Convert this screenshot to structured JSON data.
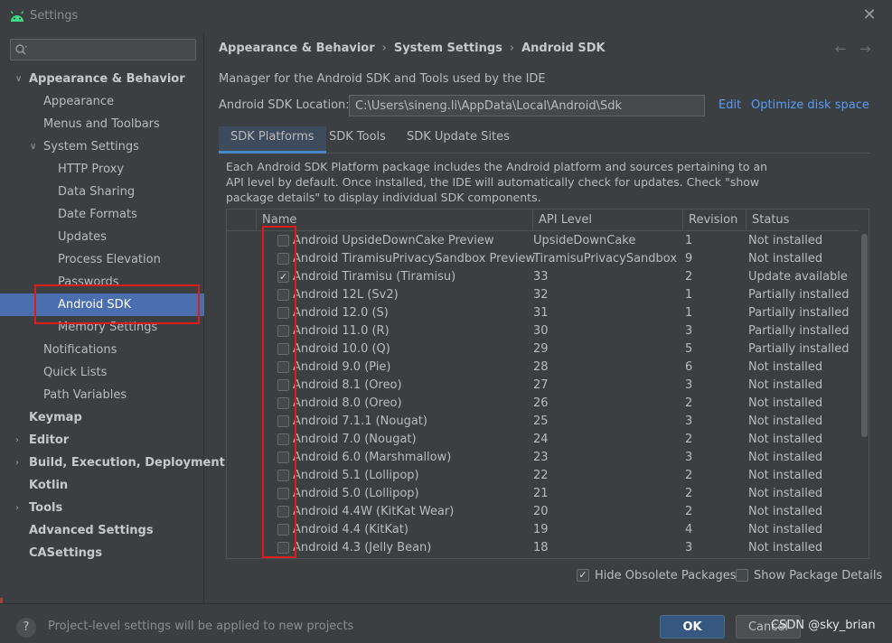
{
  "window": {
    "title": "Settings",
    "app_icon": "android-icon",
    "close_icon": "close-icon"
  },
  "sidebar": {
    "search_placeholder": "",
    "items": [
      {
        "label": "Appearance & Behavior",
        "bold": true,
        "chevron": "expanded",
        "level": 0
      },
      {
        "label": "Appearance",
        "level": 1
      },
      {
        "label": "Menus and Toolbars",
        "level": 1
      },
      {
        "label": "System Settings",
        "chevron": "expanded",
        "level": 1
      },
      {
        "label": "HTTP Proxy",
        "level": 2
      },
      {
        "label": "Data Sharing",
        "level": 2
      },
      {
        "label": "Date Formats",
        "level": 2
      },
      {
        "label": "Updates",
        "level": 2
      },
      {
        "label": "Process Elevation",
        "level": 2
      },
      {
        "label": "Passwords",
        "level": 2
      },
      {
        "label": "Android SDK",
        "level": 2,
        "selected": true
      },
      {
        "label": "Memory Settings",
        "level": 2
      },
      {
        "label": "Notifications",
        "level": 1
      },
      {
        "label": "Quick Lists",
        "level": 1
      },
      {
        "label": "Path Variables",
        "level": 1
      },
      {
        "label": "Keymap",
        "bold": true,
        "level": 0
      },
      {
        "label": "Editor",
        "bold": true,
        "chevron": "collapsed",
        "level": 0
      },
      {
        "label": "Build, Execution, Deployment",
        "bold": true,
        "chevron": "collapsed",
        "level": 0
      },
      {
        "label": "Kotlin",
        "bold": true,
        "level": 0
      },
      {
        "label": "Tools",
        "bold": true,
        "chevron": "collapsed",
        "level": 0
      },
      {
        "label": "Advanced Settings",
        "bold": true,
        "level": 0
      },
      {
        "label": "CASettings",
        "bold": true,
        "level": 0
      }
    ]
  },
  "breadcrumb": [
    "Appearance & Behavior",
    "System Settings",
    "Android SDK"
  ],
  "breadcrumb_sep": "›",
  "nav": {
    "back": "←",
    "forward": "→"
  },
  "main": {
    "description": "Manager for the Android SDK and Tools used by the IDE",
    "sdk_location_label": "Android SDK Location:",
    "sdk_location_value": "C:\\Users\\sineng.li\\AppData\\Local\\Android\\Sdk",
    "edit_link": "Edit",
    "optimize_link": "Optimize disk space",
    "tabs": [
      {
        "label": "SDK Platforms",
        "active": true
      },
      {
        "label": "SDK Tools"
      },
      {
        "label": "SDK Update Sites"
      }
    ],
    "tab_description": "Each Android SDK Platform package includes the Android platform and sources pertaining to an API level by default. Once installed, the IDE will automatically check for updates. Check \"show package details\" to display individual SDK components.",
    "columns": {
      "name": "Name",
      "api": "API Level",
      "revision": "Revision",
      "status": "Status"
    },
    "rows": [
      {
        "name": "Android UpsideDownCake Preview",
        "api": "UpsideDownCake",
        "revision": "1",
        "status": "Not installed",
        "checked": false
      },
      {
        "name": "Android TiramisuPrivacySandbox Preview",
        "api": "TiramisuPrivacySandbox",
        "revision": "9",
        "status": "Not installed",
        "checked": false
      },
      {
        "name": "Android Tiramisu (Tiramisu)",
        "api": "33",
        "revision": "2",
        "status": "Update available",
        "checked": true
      },
      {
        "name": "Android 12L (Sv2)",
        "api": "32",
        "revision": "1",
        "status": "Partially installed",
        "checked": false
      },
      {
        "name": "Android 12.0 (S)",
        "api": "31",
        "revision": "1",
        "status": "Partially installed",
        "checked": false
      },
      {
        "name": "Android 11.0 (R)",
        "api": "30",
        "revision": "3",
        "status": "Partially installed",
        "checked": false
      },
      {
        "name": "Android 10.0 (Q)",
        "api": "29",
        "revision": "5",
        "status": "Partially installed",
        "checked": false
      },
      {
        "name": "Android 9.0 (Pie)",
        "api": "28",
        "revision": "6",
        "status": "Not installed",
        "checked": false
      },
      {
        "name": "Android 8.1 (Oreo)",
        "api": "27",
        "revision": "3",
        "status": "Not installed",
        "checked": false
      },
      {
        "name": "Android 8.0 (Oreo)",
        "api": "26",
        "revision": "2",
        "status": "Not installed",
        "checked": false
      },
      {
        "name": "Android 7.1.1 (Nougat)",
        "api": "25",
        "revision": "3",
        "status": "Not installed",
        "checked": false
      },
      {
        "name": "Android 7.0 (Nougat)",
        "api": "24",
        "revision": "2",
        "status": "Not installed",
        "checked": false
      },
      {
        "name": "Android 6.0 (Marshmallow)",
        "api": "23",
        "revision": "3",
        "status": "Not installed",
        "checked": false
      },
      {
        "name": "Android 5.1 (Lollipop)",
        "api": "22",
        "revision": "2",
        "status": "Not installed",
        "checked": false
      },
      {
        "name": "Android 5.0 (Lollipop)",
        "api": "21",
        "revision": "2",
        "status": "Not installed",
        "checked": false
      },
      {
        "name": "Android 4.4W (KitKat Wear)",
        "api": "20",
        "revision": "2",
        "status": "Not installed",
        "checked": false
      },
      {
        "name": "Android 4.4 (KitKat)",
        "api": "19",
        "revision": "4",
        "status": "Not installed",
        "checked": false
      },
      {
        "name": "Android 4.3 (Jelly Bean)",
        "api": "18",
        "revision": "3",
        "status": "Not installed",
        "checked": false
      }
    ],
    "hide_obsolete": {
      "label": "Hide Obsolete Packages",
      "checked": true
    },
    "show_details": {
      "label": "Show Package Details",
      "checked": false
    }
  },
  "footer": {
    "help_glyph": "?",
    "text": "Project-level settings will be applied to new projects",
    "ok": "OK",
    "cancel": "Cancel",
    "watermark": "CSDN @sky_brian"
  },
  "colors": {
    "accent": "#4b6eaf",
    "link": "#589df6",
    "annotation": "#e01b1b",
    "background": "#3c3f41"
  },
  "check_glyph": "✓"
}
